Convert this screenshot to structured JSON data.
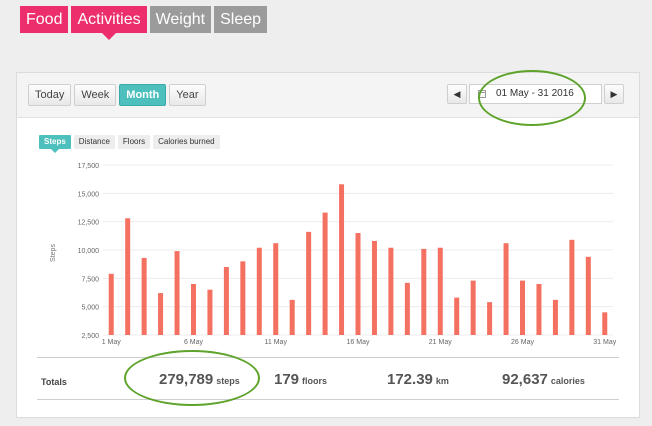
{
  "category_tabs": [
    {
      "label": "Food",
      "active": false
    },
    {
      "label": "Activities",
      "active": true
    },
    {
      "label": "Weight",
      "active": false
    },
    {
      "label": "Sleep",
      "active": false
    }
  ],
  "range_tabs": [
    {
      "label": "Today",
      "active": false
    },
    {
      "label": "Week",
      "active": false
    },
    {
      "label": "Month",
      "active": true
    },
    {
      "label": "Year",
      "active": false
    }
  ],
  "date_range": "01 May - 31 2016",
  "nav": {
    "prev_symbol": "◀",
    "next_symbol": "▶"
  },
  "metric_tabs": [
    {
      "label": "Steps",
      "active": true
    },
    {
      "label": "Distance",
      "active": false
    },
    {
      "label": "Floors",
      "active": false
    },
    {
      "label": "Calories burned",
      "active": false
    }
  ],
  "chart_data": {
    "type": "bar",
    "ylabel": "Steps",
    "ylim": [
      2500,
      17500
    ],
    "yticks": [
      "2,500",
      "5,000",
      "7,500",
      "10,000",
      "12,500",
      "15,000",
      "17,500"
    ],
    "ytick_values": [
      2500,
      5000,
      7500,
      10000,
      12500,
      15000,
      17500
    ],
    "xtick_labels": [
      {
        "day": 1,
        "label": "1 May"
      },
      {
        "day": 6,
        "label": "6 May"
      },
      {
        "day": 11,
        "label": "11 May"
      },
      {
        "day": 16,
        "label": "16 May"
      },
      {
        "day": 21,
        "label": "21 May"
      },
      {
        "day": 26,
        "label": "26 May"
      },
      {
        "day": 31,
        "label": "31 May"
      }
    ],
    "bar_color": "#f47060",
    "categories": [
      1,
      2,
      3,
      4,
      5,
      6,
      7,
      8,
      9,
      10,
      11,
      12,
      13,
      14,
      15,
      16,
      17,
      18,
      19,
      20,
      21,
      22,
      23,
      24,
      25,
      26,
      27,
      28,
      29,
      30,
      31
    ],
    "values": [
      7900,
      12800,
      9300,
      6200,
      9900,
      7000,
      6500,
      8500,
      9000,
      10200,
      10600,
      5600,
      11600,
      13300,
      15800,
      11500,
      10800,
      10200,
      7100,
      10100,
      10200,
      5800,
      7300,
      5400,
      10600,
      7300,
      7000,
      5600,
      10900,
      9400,
      4500
    ]
  },
  "totals": {
    "label": "Totals",
    "steps": {
      "value": "279,789",
      "unit": "steps"
    },
    "floors": {
      "value": "179",
      "unit": "floors"
    },
    "distance": {
      "value": "172.39",
      "unit": "km"
    },
    "calories": {
      "value": "92,637",
      "unit": "calories"
    }
  },
  "annotation_color": "#5ea32b"
}
